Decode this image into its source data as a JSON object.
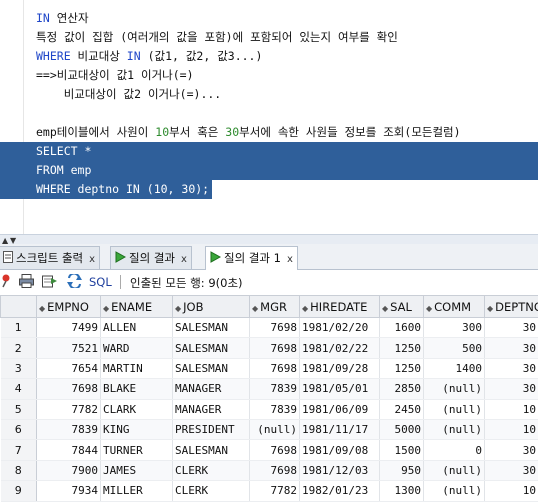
{
  "editor": {
    "lines": [
      {
        "parts": [
          {
            "t": "IN",
            "c": "kw"
          },
          {
            "t": " 연산자",
            "c": "plain"
          }
        ]
      },
      {
        "parts": [
          {
            "t": "특정 값이 집합 (여러개의 값을 포함)에 포함되어 있는지 여부를 확인",
            "c": "plain"
          }
        ]
      },
      {
        "parts": [
          {
            "t": "WHERE",
            "c": "kw"
          },
          {
            "t": " 비교대상 ",
            "c": "plain"
          },
          {
            "t": "IN",
            "c": "kw"
          },
          {
            "t": " (값1, 값2, 값3...)",
            "c": "plain"
          }
        ]
      },
      {
        "parts": [
          {
            "t": "==>비교대상이 값1 이거나(=)",
            "c": "plain"
          }
        ]
      },
      {
        "parts": [
          {
            "t": "    비교대상이 값2 이거나(=)...",
            "c": "plain"
          }
        ]
      },
      {
        "parts": [
          {
            "t": "",
            "c": "plain"
          }
        ]
      },
      {
        "parts": [
          {
            "t": "emp테이블에서 사원이 ",
            "c": "plain"
          },
          {
            "t": "10",
            "c": "num"
          },
          {
            "t": "부서 혹은 ",
            "c": "plain"
          },
          {
            "t": "30",
            "c": "num"
          },
          {
            "t": "부서에 속한 사원들 정보를 조회(모든컬럼)",
            "c": "plain"
          }
        ]
      },
      {
        "selected": "full",
        "parts": [
          {
            "t": "SELECT *",
            "c": "selected"
          }
        ]
      },
      {
        "selected": "full",
        "parts": [
          {
            "t": "FROM emp",
            "c": "selected"
          }
        ]
      },
      {
        "selected": "part",
        "parts": [
          {
            "t": "WHERE deptno IN (10, 30);",
            "c": "selected"
          }
        ]
      }
    ]
  },
  "tabs": [
    {
      "label": "스크립트 출력",
      "icon": "script-output-icon",
      "closable": true,
      "active": false
    },
    {
      "label": "질의 결과",
      "icon": "query-result-icon",
      "closable": true,
      "active": false
    },
    {
      "label": "질의 결과 1",
      "icon": "query-result-icon",
      "closable": true,
      "active": true
    }
  ],
  "toolbar": {
    "sql_label": "SQL",
    "status": "인출된 모든 행: 9(0초)"
  },
  "grid": {
    "columns": [
      "EMPNO",
      "ENAME",
      "JOB",
      "MGR",
      "HIREDATE",
      "SAL",
      "COMM",
      "DEPTNO"
    ],
    "rows": [
      {
        "rn": "1",
        "cells": [
          "7499",
          "ALLEN",
          "SALESMAN",
          "7698",
          "1981/02/20",
          "1600",
          "300",
          "30"
        ]
      },
      {
        "rn": "2",
        "cells": [
          "7521",
          "WARD",
          "SALESMAN",
          "7698",
          "1981/02/22",
          "1250",
          "500",
          "30"
        ]
      },
      {
        "rn": "3",
        "cells": [
          "7654",
          "MARTIN",
          "SALESMAN",
          "7698",
          "1981/09/28",
          "1250",
          "1400",
          "30"
        ]
      },
      {
        "rn": "4",
        "cells": [
          "7698",
          "BLAKE",
          "MANAGER",
          "7839",
          "1981/05/01",
          "2850",
          "(null)",
          "30"
        ]
      },
      {
        "rn": "5",
        "cells": [
          "7782",
          "CLARK",
          "MANAGER",
          "7839",
          "1981/06/09",
          "2450",
          "(null)",
          "10"
        ]
      },
      {
        "rn": "6",
        "cells": [
          "7839",
          "KING",
          "PRESIDENT",
          "(null)",
          "1981/11/17",
          "5000",
          "(null)",
          "10"
        ]
      },
      {
        "rn": "7",
        "cells": [
          "7844",
          "TURNER",
          "SALESMAN",
          "7698",
          "1981/09/08",
          "1500",
          "0",
          "30"
        ]
      },
      {
        "rn": "8",
        "cells": [
          "7900",
          "JAMES",
          "CLERK",
          "7698",
          "1981/12/03",
          "950",
          "(null)",
          "30"
        ]
      },
      {
        "rn": "9",
        "cells": [
          "7934",
          "MILLER",
          "CLERK",
          "7782",
          "1982/01/23",
          "1300",
          "(null)",
          "10"
        ]
      }
    ]
  }
}
